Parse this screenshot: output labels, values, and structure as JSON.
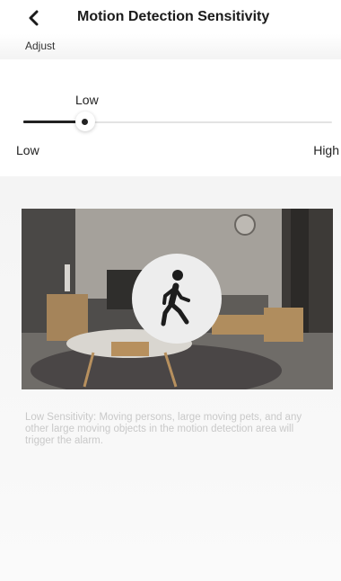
{
  "header": {
    "title": "Motion Detection Sensitivity",
    "back_icon": "chevron-left-icon"
  },
  "section": {
    "label": "Adjust"
  },
  "slider": {
    "current_label": "Low",
    "min_label": "Low",
    "max_label": "High",
    "level_fraction": 0.2
  },
  "preview": {
    "icon": "walking-person-icon"
  },
  "description": "Low Sensitivity: Moving persons, large moving pets, and any other large moving objects in the motion detection area will trigger the alarm.",
  "colors": {
    "slider_fill": "#222222",
    "track": "#e3e3e3",
    "description_text": "#c9c9c9"
  }
}
